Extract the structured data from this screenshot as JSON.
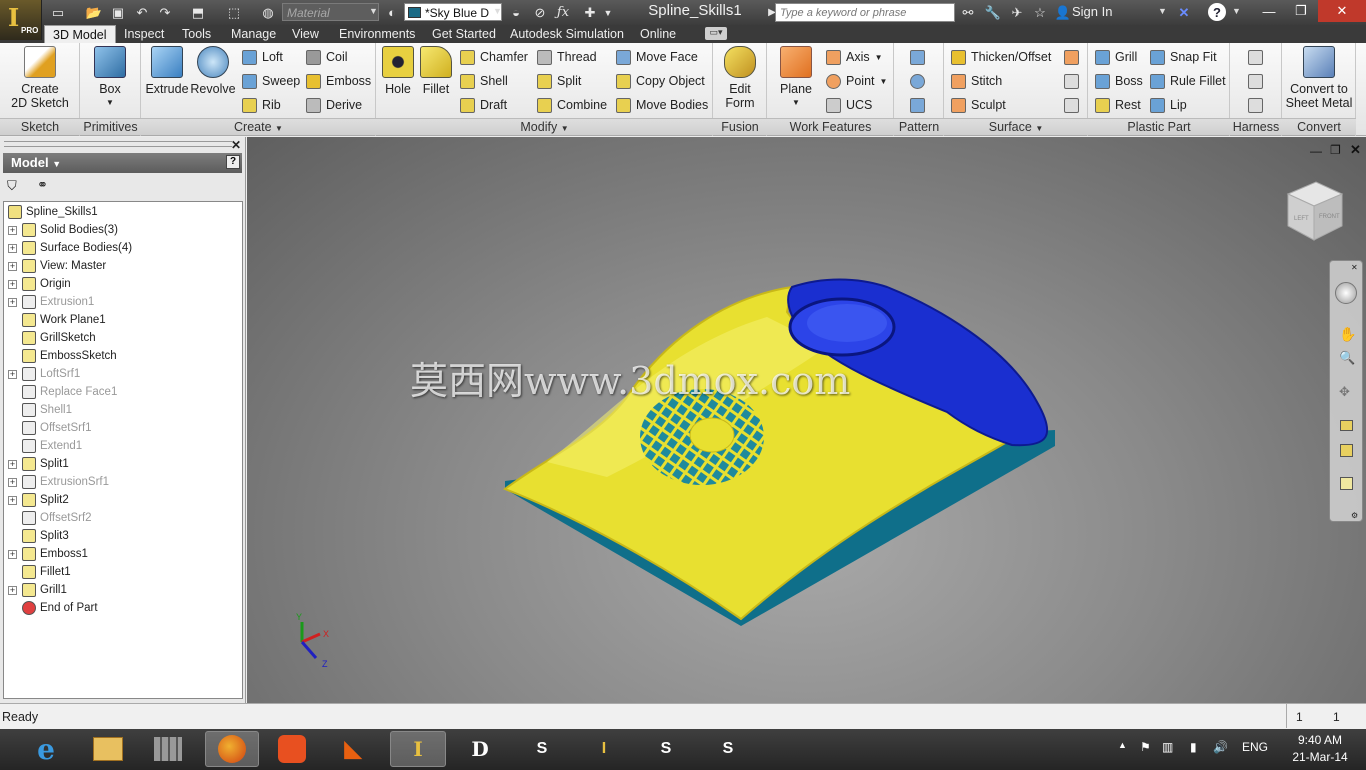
{
  "app": {
    "title": "Spline_Skills1",
    "logo_badge": "PRO"
  },
  "quick_access": {
    "material_placeholder": "Material",
    "appearance_value": "*Sky Blue D",
    "search_placeholder": "Type a keyword or phrase",
    "sign_in": "Sign In"
  },
  "menu_tabs": [
    "3D Model",
    "Inspect",
    "Tools",
    "Manage",
    "View",
    "Environments",
    "Get Started",
    "Autodesk Simulation",
    "Online"
  ],
  "ribbon": {
    "sketch": {
      "create_2d_sketch": "Create\n2D Sketch",
      "label": "Sketch"
    },
    "primitives": {
      "box": "Box",
      "label": "Primitives"
    },
    "create": {
      "extrude": "Extrude",
      "revolve": "Revolve",
      "loft": "Loft",
      "sweep": "Sweep",
      "rib": "Rib",
      "coil": "Coil",
      "emboss": "Emboss",
      "derive": "Derive",
      "label": "Create"
    },
    "modify": {
      "hole": "Hole",
      "fillet": "Fillet",
      "chamfer": "Chamfer",
      "shell": "Shell",
      "draft": "Draft",
      "thread": "Thread",
      "split": "Split",
      "combine": "Combine",
      "move_face": "Move Face",
      "copy_object": "Copy Object",
      "move_bodies": "Move Bodies",
      "label": "Modify"
    },
    "fusion": {
      "edit_form": "Edit\nForm",
      "label": "Fusion"
    },
    "work_features": {
      "plane": "Plane",
      "axis": "Axis",
      "point": "Point",
      "ucs": "UCS",
      "label": "Work Features"
    },
    "pattern": {
      "label": "Pattern"
    },
    "surface": {
      "thicken_offset": "Thicken/Offset",
      "stitch": "Stitch",
      "sculpt": "Sculpt",
      "label": "Surface"
    },
    "plastic_part": {
      "grill": "Grill",
      "boss": "Boss",
      "rest": "Rest",
      "snap_fit": "Snap Fit",
      "rule_fillet": "Rule Fillet",
      "lip": "Lip",
      "label": "Plastic Part"
    },
    "harness": {
      "label": "Harness"
    },
    "convert": {
      "convert_to_sheet_metal": "Convert to\nSheet Metal",
      "label": "Convert"
    }
  },
  "browser": {
    "title": "Model",
    "tree": [
      {
        "label": "Spline_Skills1",
        "expandable": false,
        "dim": false,
        "root": true
      },
      {
        "label": "Solid Bodies(3)",
        "expandable": true,
        "dim": false
      },
      {
        "label": "Surface Bodies(4)",
        "expandable": true,
        "dim": false
      },
      {
        "label": "View: Master",
        "expandable": true,
        "dim": false
      },
      {
        "label": "Origin",
        "expandable": true,
        "dim": false
      },
      {
        "label": "Extrusion1",
        "expandable": true,
        "dim": true
      },
      {
        "label": "Work Plane1",
        "expandable": false,
        "dim": false
      },
      {
        "label": "GrillSketch",
        "expandable": false,
        "dim": false
      },
      {
        "label": "EmbossSketch",
        "expandable": false,
        "dim": false
      },
      {
        "label": "LoftSrf1",
        "expandable": true,
        "dim": true
      },
      {
        "label": "Replace Face1",
        "expandable": false,
        "dim": true
      },
      {
        "label": "Shell1",
        "expandable": false,
        "dim": true
      },
      {
        "label": "OffsetSrf1",
        "expandable": false,
        "dim": true
      },
      {
        "label": "Extend1",
        "expandable": false,
        "dim": true
      },
      {
        "label": "Split1",
        "expandable": true,
        "dim": false
      },
      {
        "label": "ExtrusionSrf1",
        "expandable": true,
        "dim": true
      },
      {
        "label": "Split2",
        "expandable": true,
        "dim": false
      },
      {
        "label": "OffsetSrf2",
        "expandable": false,
        "dim": true
      },
      {
        "label": "Split3",
        "expandable": false,
        "dim": false
      },
      {
        "label": "Emboss1",
        "expandable": true,
        "dim": false
      },
      {
        "label": "Fillet1",
        "expandable": false,
        "dim": false
      },
      {
        "label": "Grill1",
        "expandable": true,
        "dim": false
      },
      {
        "label": "End of Part",
        "expandable": false,
        "dim": false,
        "end": true
      }
    ]
  },
  "viewport": {
    "watermark": "莫西网www.3dmox.com",
    "viewcube": {
      "left": "LEFT",
      "front": "FRONT"
    },
    "triad": {
      "x": "X",
      "y": "Y",
      "z": "Z"
    }
  },
  "status": {
    "text": "Ready",
    "count_a": "1",
    "count_b": "1"
  },
  "taskbar": {
    "lang": "ENG",
    "time": "9:40 AM",
    "date": "21-Mar-14"
  },
  "colors": {
    "model_yellow": "#e8e030",
    "model_blue": "#1a2fd0",
    "model_base": "#0f6f8a",
    "accent_red": "#c0392b"
  }
}
